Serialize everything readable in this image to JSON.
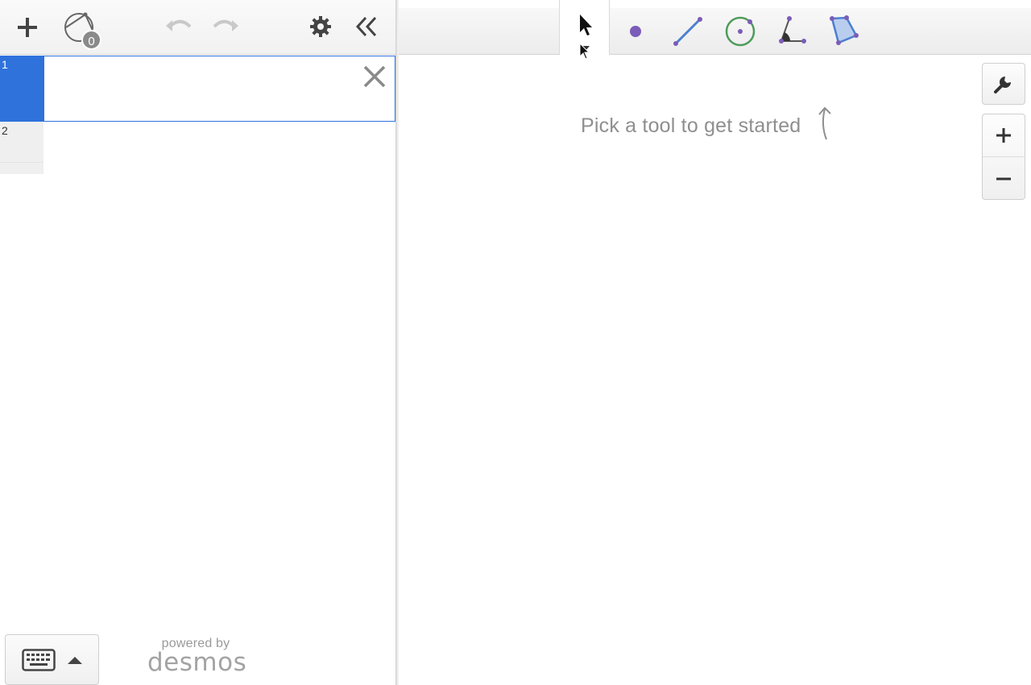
{
  "left_toolbar": {
    "add_button": "add",
    "construction_badge": "0",
    "undo": "undo",
    "redo": "redo",
    "settings": "settings",
    "collapse": "collapse"
  },
  "expressions": [
    {
      "number": "1",
      "value": "",
      "active": true
    },
    {
      "number": "2",
      "value": "",
      "active": false
    }
  ],
  "footer": {
    "powered_by": "powered by",
    "brand": "desmos"
  },
  "tools": [
    {
      "name": "select",
      "selected": true
    },
    {
      "name": "point",
      "selected": false
    },
    {
      "name": "segment",
      "selected": false
    },
    {
      "name": "circle",
      "selected": false
    },
    {
      "name": "angle",
      "selected": false
    },
    {
      "name": "polygon",
      "selected": false
    }
  ],
  "canvas": {
    "hint_text": "Pick a tool to get started"
  },
  "colors": {
    "accent_blue": "#2f72dc",
    "point_purple": "#7b5cb8",
    "segment_blue": "#4b7fd0",
    "circle_green": "#4e9b5c",
    "hint_gray": "#8f8f8f"
  }
}
